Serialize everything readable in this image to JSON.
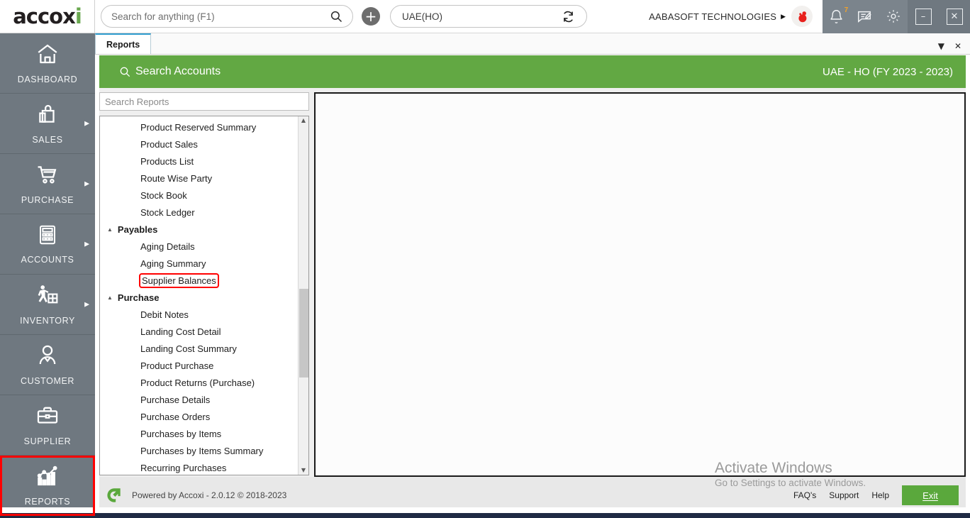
{
  "app": {
    "brand": "accoxi",
    "brand_accent": "#6aa84f",
    "green": "#62a843",
    "sidebar_bg": "#6f7880",
    "highlight_color": "#ff0000"
  },
  "topbar": {
    "search_placeholder": "Search for anything (F1)",
    "search_value": "",
    "search_icon": "search-icon",
    "add_button_label": "+",
    "branch_value": "UAE(HO)",
    "branch_switch_icon": "switch-branch-icon",
    "org_name": "AABASOFT TECHNOLOGIES",
    "org_caret": "▶",
    "notifications_count": "7",
    "notification_icon": "bell-icon",
    "notes_icon": "note-edit-icon",
    "settings_icon": "gear-icon",
    "minimize_label": "–",
    "close_label": "✕"
  },
  "sidebar": {
    "items": [
      {
        "label": "DASHBOARD",
        "icon": "home-icon",
        "has_arrow": false,
        "highlighted": false
      },
      {
        "label": "SALES",
        "icon": "shopping-bag-icon",
        "has_arrow": true,
        "highlighted": false
      },
      {
        "label": "PURCHASE",
        "icon": "shopping-cart-icon",
        "has_arrow": true,
        "highlighted": false
      },
      {
        "label": "ACCOUNTS",
        "icon": "calculator-icon",
        "has_arrow": true,
        "highlighted": false
      },
      {
        "label": "INVENTORY",
        "icon": "warehouse-worker-icon",
        "has_arrow": true,
        "highlighted": false
      },
      {
        "label": "CUSTOMER",
        "icon": "person-icon",
        "has_arrow": false,
        "highlighted": false
      },
      {
        "label": "SUPPLIER",
        "icon": "briefcase-icon",
        "has_arrow": false,
        "highlighted": false
      },
      {
        "label": "REPORTS",
        "icon": "bar-chart-icon",
        "has_arrow": false,
        "highlighted": true
      }
    ]
  },
  "tabstrip": {
    "tabs": [
      {
        "label": "Reports",
        "active": true
      }
    ],
    "dropdown_icon": "chevron-down-icon",
    "close_icon": "close-icon"
  },
  "green_header": {
    "search_icon": "search-icon",
    "title": "Search Accounts",
    "context": "UAE - HO (FY 2023 - 2023)"
  },
  "reports_panel": {
    "search_placeholder": "Search Reports",
    "search_value": "",
    "scroll_up_icon": "scroll-up-arrow-icon",
    "scroll_down_icon": "scroll-down-arrow-icon",
    "entries": [
      {
        "type": "item",
        "label": "Product Reserved Summary",
        "marked": false
      },
      {
        "type": "item",
        "label": "Product Sales",
        "marked": false
      },
      {
        "type": "item",
        "label": "Products List",
        "marked": false
      },
      {
        "type": "item",
        "label": "Route Wise Party",
        "marked": false
      },
      {
        "type": "item",
        "label": "Stock Book",
        "marked": false
      },
      {
        "type": "item",
        "label": "Stock Ledger",
        "marked": false
      },
      {
        "type": "group",
        "label": "Payables",
        "expanded": true
      },
      {
        "type": "item",
        "label": "Aging Details",
        "marked": false
      },
      {
        "type": "item",
        "label": "Aging Summary",
        "marked": false
      },
      {
        "type": "item",
        "label": "Supplier Balances",
        "marked": true
      },
      {
        "type": "group",
        "label": "Purchase",
        "expanded": true
      },
      {
        "type": "item",
        "label": "Debit Notes",
        "marked": false
      },
      {
        "type": "item",
        "label": "Landing Cost Detail",
        "marked": false
      },
      {
        "type": "item",
        "label": "Landing Cost Summary",
        "marked": false
      },
      {
        "type": "item",
        "label": "Product Purchase",
        "marked": false
      },
      {
        "type": "item",
        "label": "Product Returns (Purchase)",
        "marked": false
      },
      {
        "type": "item",
        "label": "Purchase Details",
        "marked": false
      },
      {
        "type": "item",
        "label": "Purchase Orders",
        "marked": false
      },
      {
        "type": "item",
        "label": "Purchases by Items",
        "marked": false
      },
      {
        "type": "item",
        "label": "Purchases by Items Summary",
        "marked": false
      },
      {
        "type": "item",
        "label": "Recurring Purchases",
        "marked": false
      }
    ]
  },
  "content_panel": {
    "empty": true
  },
  "footer": {
    "logo_icon": "accoxi-arrow-icon",
    "powered_by": "Powered by Accoxi - 2.0.12 © 2018-2023",
    "links": [
      "FAQ's",
      "Support",
      "Help"
    ],
    "exit_label": "Exit"
  },
  "watermark": {
    "line1": "Activate Windows",
    "line2": "Go to Settings to activate Windows."
  }
}
